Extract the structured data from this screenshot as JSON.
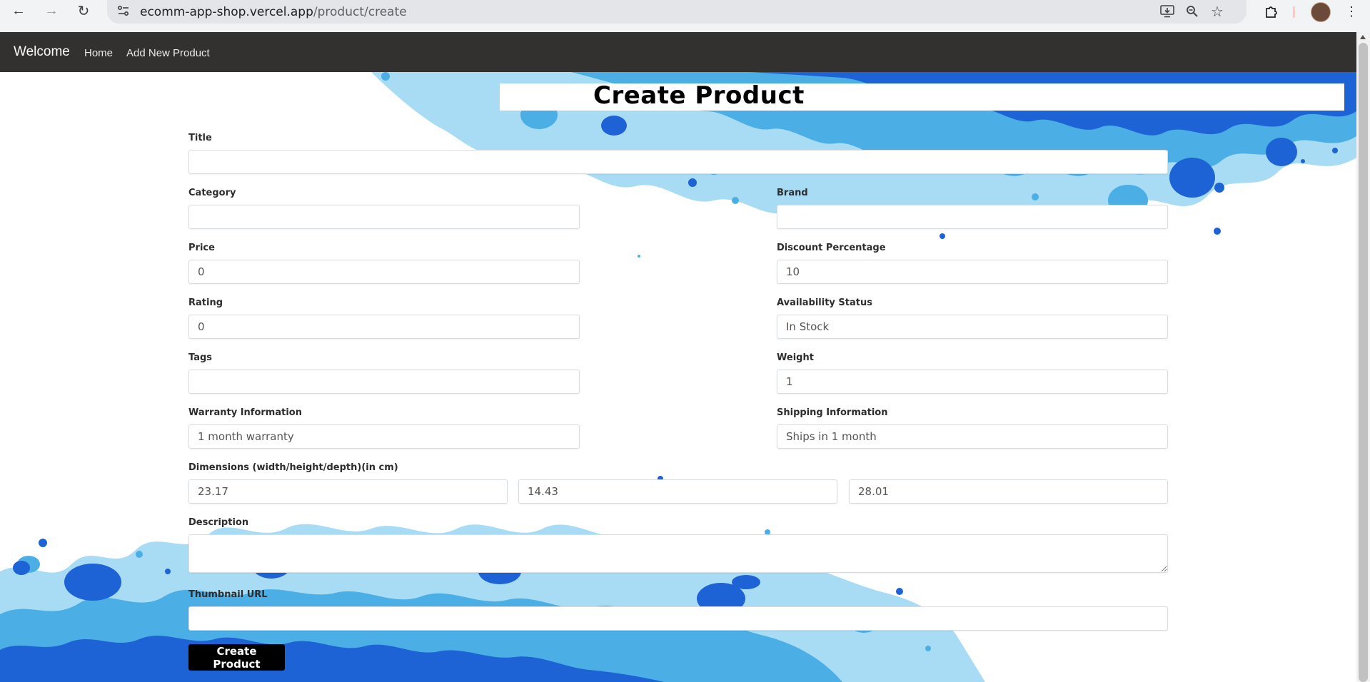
{
  "browser": {
    "url_host": "ecomm-app-shop.vercel.app",
    "url_path": "/product/create",
    "icons": [
      "back-arrow-icon",
      "forward-arrow-icon",
      "reload-icon",
      "site-info-icon",
      "install-app-icon",
      "zoom-icon",
      "bookmark-star-icon",
      "extensions-icon",
      "profile-avatar",
      "menu-dots-icon"
    ]
  },
  "navbar": {
    "brand": "Welcome",
    "links": [
      "Home",
      "Add New Product"
    ]
  },
  "page": {
    "title": "Create Product"
  },
  "form": {
    "title": {
      "label": "Title",
      "value": ""
    },
    "category": {
      "label": "Category",
      "value": ""
    },
    "brand": {
      "label": "Brand",
      "value": ""
    },
    "price": {
      "label": "Price",
      "value": "0"
    },
    "discount": {
      "label": "Discount Percentage",
      "value": "10"
    },
    "rating": {
      "label": "Rating",
      "value": "0"
    },
    "availability": {
      "label": "Availability Status",
      "value": "In Stock"
    },
    "tags": {
      "label": "Tags",
      "value": ""
    },
    "weight": {
      "label": "Weight",
      "value": "1"
    },
    "warranty": {
      "label": "Warranty Information",
      "value": "1 month warranty"
    },
    "shipping": {
      "label": "Shipping Information",
      "value": "Ships in 1 month"
    },
    "dimensions": {
      "label": "Dimensions (width/height/depth)(in cm)",
      "width": "23.17",
      "height": "14.43",
      "depth": "28.01"
    },
    "description": {
      "label": "Description",
      "value": ""
    },
    "thumbnail": {
      "label": "Thumbnail URL",
      "value": ""
    },
    "submit_label": "Create Product"
  },
  "colors": {
    "navbar_bg": "#333030",
    "splash_dark": "#1e63d6",
    "splash_mid": "#4bafe6",
    "splash_light": "#a8dcf5",
    "button_bg": "#000000"
  }
}
